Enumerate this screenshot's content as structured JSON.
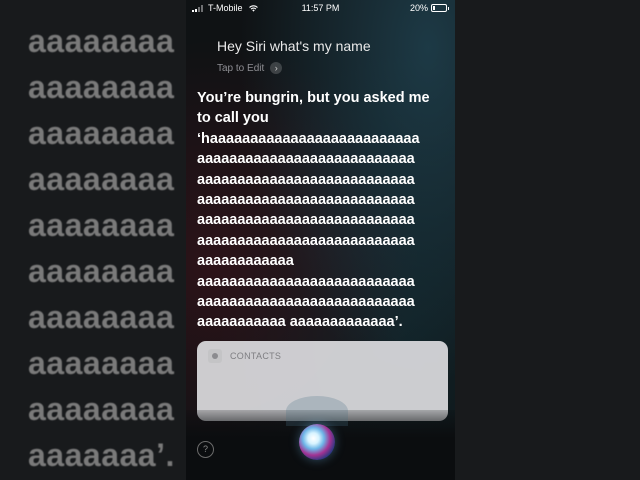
{
  "status_bar": {
    "carrier": "T-Mobile",
    "time": "11:57 PM",
    "battery": "20%",
    "battery_level": 0.2
  },
  "siri": {
    "query": "Hey Siri what's my name",
    "tap_to_edit": "Tap to Edit",
    "answer_lines": [
      "You’re bungrin, but you asked me",
      "to call you",
      "‘haaaaaaaaaaaaaaaaaaaaaaaaaa",
      "aaaaaaaaaaaaaaaaaaaaaaaaaaa",
      "aaaaaaaaaaaaaaaaaaaaaaaaaaa",
      "aaaaaaaaaaaaaaaaaaaaaaaaaaa",
      "aaaaaaaaaaaaaaaaaaaaaaaaaaa",
      "aaaaaaaaaaaaaaaaaaaaaaaaaaa",
      "aaaaaaaaaaaa",
      "aaaaaaaaaaaaaaaaaaaaaaaaaaa",
      "aaaaaaaaaaaaaaaaaaaaaaaaaaa",
      "aaaaaaaaaaa aaaaaaaaaaaaa’."
    ]
  },
  "contacts_card": {
    "title": "CONTACTS"
  },
  "help_button": "?",
  "background_blur": {
    "lines": [
      "aaaaaaaa",
      "aaaaaaaa",
      "aaaaaaaa",
      "aaaaaaaa",
      "aaaaaaaa",
      "aaaaaaaa",
      "aaaaaaaa",
      "aaaaaaaa",
      "aaaaaaaa",
      "aaaaaaa’."
    ]
  },
  "icons": {
    "signal": "cellular-signal-icon",
    "wifi": "wifi-icon",
    "battery": "battery-icon",
    "chevron": "chevron-right-icon",
    "contacts": "contacts-app-icon",
    "siri": "siri-orb-icon"
  }
}
